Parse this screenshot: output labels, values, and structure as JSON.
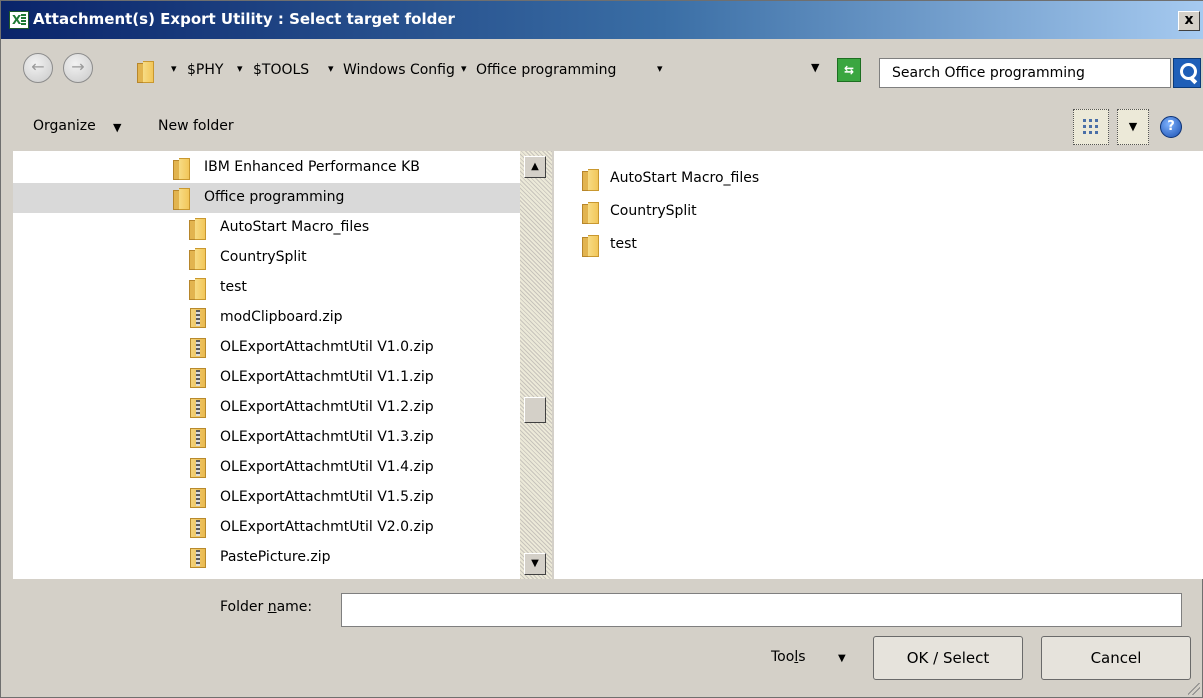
{
  "window": {
    "title": "Attachment(s) Export Utility : Select target folder",
    "app_icon": "X",
    "close_label": "x"
  },
  "nav": {
    "back_icon": "arrow-left-icon",
    "forward_icon": "arrow-right-icon"
  },
  "address": {
    "crumbs": [
      "$PHY",
      "$TOOLS",
      "Windows Config",
      "Office programming"
    ],
    "separator": "▾",
    "dropdown": "▼",
    "refresh_icon": "refresh-icon",
    "refresh_glyph": "⇆"
  },
  "search": {
    "placeholder": "Search Office programming"
  },
  "toolbar": {
    "organize_label": "Organize",
    "organize_arrow": "▼",
    "new_folder_label": "New folder",
    "view_dd_arrow": "▼",
    "help_label": "?"
  },
  "tree": {
    "items": [
      {
        "label": "IBM Enhanced Performance KB",
        "type": "folder",
        "indent": 1,
        "selected": false
      },
      {
        "label": "Office programming",
        "type": "folder-open",
        "indent": 1,
        "selected": true
      },
      {
        "label": "AutoStart Macro_files",
        "type": "folder",
        "indent": 2,
        "selected": false
      },
      {
        "label": "CountrySplit",
        "type": "folder",
        "indent": 2,
        "selected": false
      },
      {
        "label": "test",
        "type": "folder",
        "indent": 2,
        "selected": false
      },
      {
        "label": "modClipboard.zip",
        "type": "zip",
        "indent": 2,
        "selected": false
      },
      {
        "label": "OLExportAttachmtUtil V1.0.zip",
        "type": "zip",
        "indent": 2,
        "selected": false
      },
      {
        "label": "OLExportAttachmtUtil V1.1.zip",
        "type": "zip",
        "indent": 2,
        "selected": false
      },
      {
        "label": "OLExportAttachmtUtil V1.2.zip",
        "type": "zip",
        "indent": 2,
        "selected": false
      },
      {
        "label": "OLExportAttachmtUtil V1.3.zip",
        "type": "zip",
        "indent": 2,
        "selected": false
      },
      {
        "label": "OLExportAttachmtUtil V1.4.zip",
        "type": "zip",
        "indent": 2,
        "selected": false
      },
      {
        "label": "OLExportAttachmtUtil V1.5.zip",
        "type": "zip",
        "indent": 2,
        "selected": false
      },
      {
        "label": "OLExportAttachmtUtil V2.0.zip",
        "type": "zip",
        "indent": 2,
        "selected": false
      },
      {
        "label": "PastePicture.zip",
        "type": "zip",
        "indent": 2,
        "selected": false
      }
    ],
    "scroll_up": "▲",
    "scroll_down": "▼"
  },
  "content": {
    "items": [
      "AutoStart Macro_files",
      "CountrySplit",
      "test"
    ]
  },
  "bottom": {
    "folder_name_pre": "Folder ",
    "folder_name_accel": "n",
    "folder_name_post": "ame:",
    "folder_name_value": "",
    "tools_pre": "Too",
    "tools_accel": "l",
    "tools_post": "s",
    "tools_arrow": "▼",
    "ok_label": "OK / Select",
    "cancel_label": "Cancel"
  }
}
